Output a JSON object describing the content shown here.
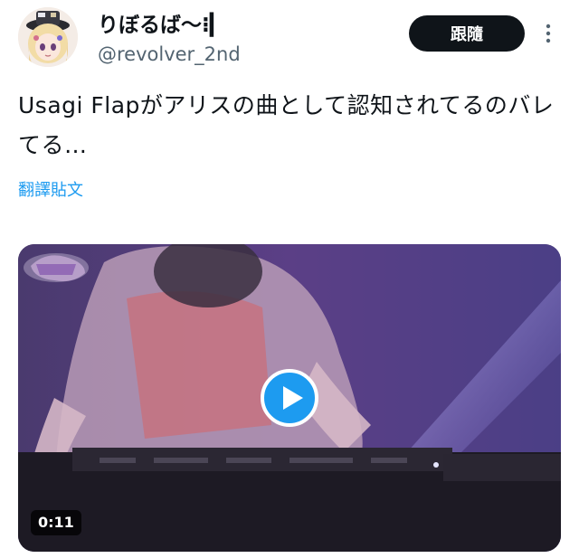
{
  "author": {
    "display_name": "りぼるば〜⁝▎",
    "handle": "@revolver_2nd"
  },
  "header": {
    "follow_label": "跟隨"
  },
  "tweet": {
    "text": "Usagi Flapがアリスの曲として認知されてるのバレてる…",
    "translate_label": "翻譯貼文"
  },
  "media": {
    "duration": "0:11"
  },
  "colors": {
    "accent_link": "#1d9bf0",
    "follow_button_bg": "#0f1419",
    "play_button_bg": "#1d9bf0",
    "secondary_text": "#536471"
  },
  "icons": {
    "more": "more-vertical-icon",
    "play": "play-icon",
    "avatar": "avatar"
  }
}
